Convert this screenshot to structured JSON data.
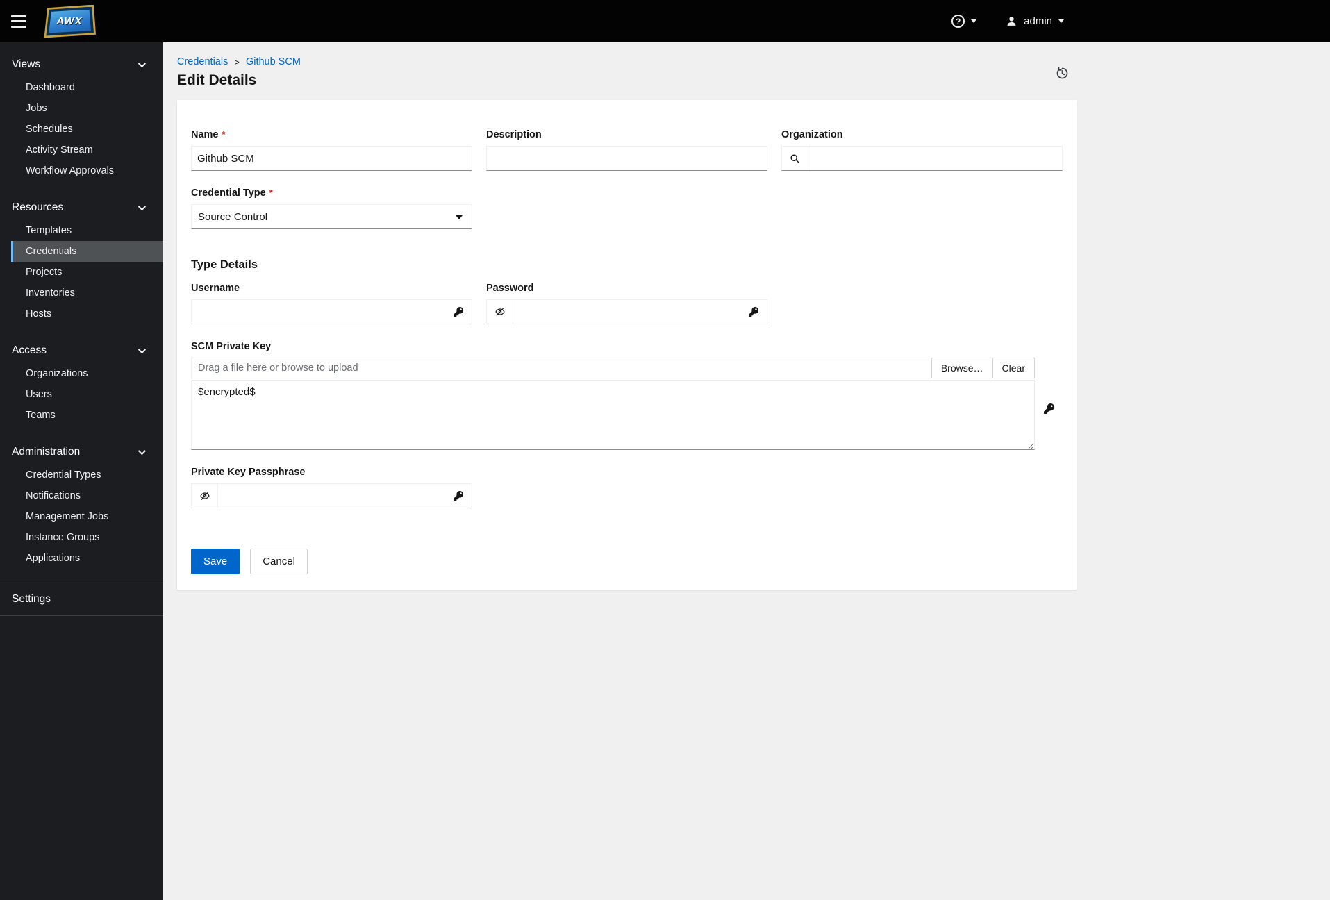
{
  "topbar": {
    "brand": "AWX",
    "user": "admin",
    "help_glyph": "?"
  },
  "sidebar": {
    "sections": [
      {
        "label": "Views",
        "items": [
          "Dashboard",
          "Jobs",
          "Schedules",
          "Activity Stream",
          "Workflow Approvals"
        ]
      },
      {
        "label": "Resources",
        "items": [
          "Templates",
          "Credentials",
          "Projects",
          "Inventories",
          "Hosts"
        ]
      },
      {
        "label": "Access",
        "items": [
          "Organizations",
          "Users",
          "Teams"
        ]
      },
      {
        "label": "Administration",
        "items": [
          "Credential Types",
          "Notifications",
          "Management Jobs",
          "Instance Groups",
          "Applications"
        ]
      }
    ],
    "settings_label": "Settings",
    "active_item": "Credentials"
  },
  "breadcrumb": {
    "items": [
      "Credentials",
      "Github SCM"
    ],
    "separator": ">"
  },
  "page": {
    "title": "Edit Details"
  },
  "form": {
    "required_marker": "*",
    "name": {
      "label": "Name",
      "value": "Github SCM"
    },
    "description": {
      "label": "Description",
      "value": ""
    },
    "organization": {
      "label": "Organization",
      "value": ""
    },
    "credential_type": {
      "label": "Credential Type",
      "value": "Source Control"
    },
    "section_heading": "Type Details",
    "username": {
      "label": "Username",
      "value": ""
    },
    "password": {
      "label": "Password",
      "value": ""
    },
    "scm_private_key": {
      "label": "SCM Private Key",
      "upload_placeholder": "Drag a file here or browse to upload",
      "browse_label": "Browse…",
      "clear_label": "Clear",
      "value": "$encrypted$"
    },
    "private_key_passphrase": {
      "label": "Private Key Passphrase",
      "value": ""
    },
    "actions": {
      "save": "Save",
      "cancel": "Cancel"
    }
  },
  "colors": {
    "accent": "#0066cc",
    "required": "#c9190b",
    "topbar_bg": "#030303",
    "sidebar_bg": "#1b1d21",
    "active_nav_bg": "#4f5255",
    "active_nav_border": "#73bcf7",
    "content_bg": "#f0f0f0"
  }
}
